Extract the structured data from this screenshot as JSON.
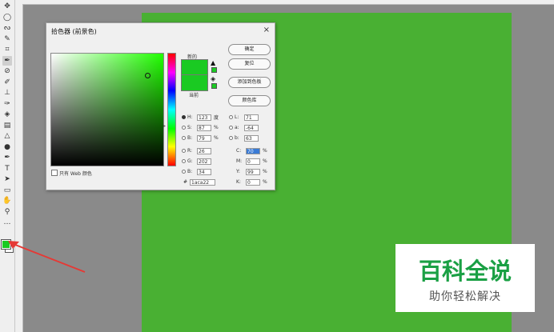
{
  "tools": [
    {
      "name": "move-icon",
      "glyph": "✥"
    },
    {
      "name": "ellipse-marquee-icon",
      "glyph": "◯"
    },
    {
      "name": "lasso-icon",
      "glyph": "ᔓ"
    },
    {
      "name": "quick-select-icon",
      "glyph": "✎"
    },
    {
      "name": "crop-icon",
      "glyph": "⌗"
    },
    {
      "name": "eyedropper-icon",
      "glyph": "✒"
    },
    {
      "name": "healing-icon",
      "glyph": "⊘"
    },
    {
      "name": "brush-icon",
      "glyph": "✐"
    },
    {
      "name": "stamp-icon",
      "glyph": "⊥"
    },
    {
      "name": "history-brush-icon",
      "glyph": "✑"
    },
    {
      "name": "eraser-icon",
      "glyph": "◈"
    },
    {
      "name": "gradient-icon",
      "glyph": "▤"
    },
    {
      "name": "blur-icon",
      "glyph": "△"
    },
    {
      "name": "dodge-icon",
      "glyph": "●"
    },
    {
      "name": "pen-icon",
      "glyph": "✒"
    },
    {
      "name": "type-icon",
      "glyph": "T"
    },
    {
      "name": "path-select-icon",
      "glyph": "➤"
    },
    {
      "name": "shape-icon",
      "glyph": "▭"
    },
    {
      "name": "hand-icon",
      "glyph": "✋"
    },
    {
      "name": "zoom-icon",
      "glyph": "⚲"
    },
    {
      "name": "more-tools-icon",
      "glyph": "…"
    }
  ],
  "colors": {
    "foreground": "#1aca22",
    "canvas": "#49b033"
  },
  "dialog": {
    "title": "拾色器 (前景色)",
    "close": "×",
    "new_label": "新的",
    "current_label": "当前",
    "buttons": {
      "ok": "确定",
      "reset": "复位",
      "add_swatch": "添加到色板",
      "library": "颜色库"
    },
    "fields": [
      {
        "name": "H:",
        "value": "123",
        "unit": "度",
        "radio": true,
        "selected": true
      },
      {
        "name": "S:",
        "value": "87",
        "unit": "%",
        "radio": true
      },
      {
        "name": "B:",
        "value": "79",
        "unit": "%",
        "radio": true
      },
      {
        "name": "R:",
        "value": "26",
        "unit": "",
        "radio": true
      },
      {
        "name": "G:",
        "value": "202",
        "unit": "",
        "radio": true
      },
      {
        "name": "B:",
        "value": "34",
        "unit": "",
        "radio": true
      }
    ],
    "lab_fields": [
      {
        "name": "L:",
        "value": "71"
      },
      {
        "name": "a:",
        "value": "-64"
      },
      {
        "name": "b:",
        "value": "63"
      }
    ],
    "cmyk_fields": [
      {
        "name": "C:",
        "value": "70",
        "unit": "%"
      },
      {
        "name": "M:",
        "value": "0",
        "unit": "%"
      },
      {
        "name": "Y:",
        "value": "99",
        "unit": "%"
      },
      {
        "name": "K:",
        "value": "0",
        "unit": "%"
      }
    ],
    "hex_label": "#",
    "hex_value": "1aca22",
    "web_only_label": "只有 Web 颜色"
  },
  "watermark": {
    "title": "百科全说",
    "subtitle": "助你轻松解决"
  }
}
